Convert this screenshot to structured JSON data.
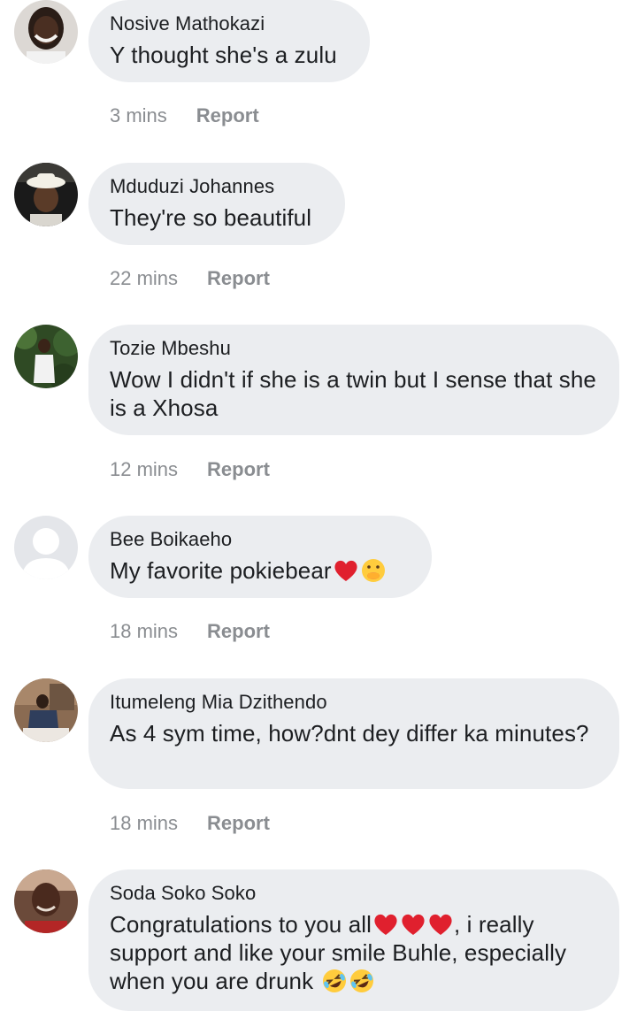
{
  "comments": [
    {
      "author": "Nosive Mathokazi",
      "text": "Y thought she's a zulu",
      "time": "3 mins",
      "action": "Report"
    },
    {
      "author": "Mduduzi Johannes",
      "text": "They're so beautiful",
      "time": "22 mins",
      "action": "Report"
    },
    {
      "author": "Tozie Mbeshu",
      "text": "Wow I didn't if she is a twin but I sense that she is a Xhosa",
      "time": "12 mins",
      "action": "Report"
    },
    {
      "author": "Bee Boikaeho",
      "text": "My favorite pokiebear",
      "time": "18 mins",
      "action": "Report"
    },
    {
      "author": "Itumeleng Mia Dzithendo",
      "text": "As 4 sym time, how?dnt dey differ ka minutes?",
      "time": "18 mins",
      "action": "Report"
    },
    {
      "author": "Soda Soko Soko",
      "text_part1": "Congratulations to you all",
      "text_part2": ", i really support and like your smile Buhle, especially when you are drunk ",
      "time": "",
      "action": ""
    }
  ],
  "icons": {
    "heart": "red-heart-emoji",
    "surprised": "face-with-hand-over-mouth-emoji",
    "laughing": "rolling-on-floor-laughing-emoji"
  },
  "colors": {
    "bubble": "#ebedf0",
    "meta_text": "#8a8d91",
    "heart": "#e0202e"
  }
}
